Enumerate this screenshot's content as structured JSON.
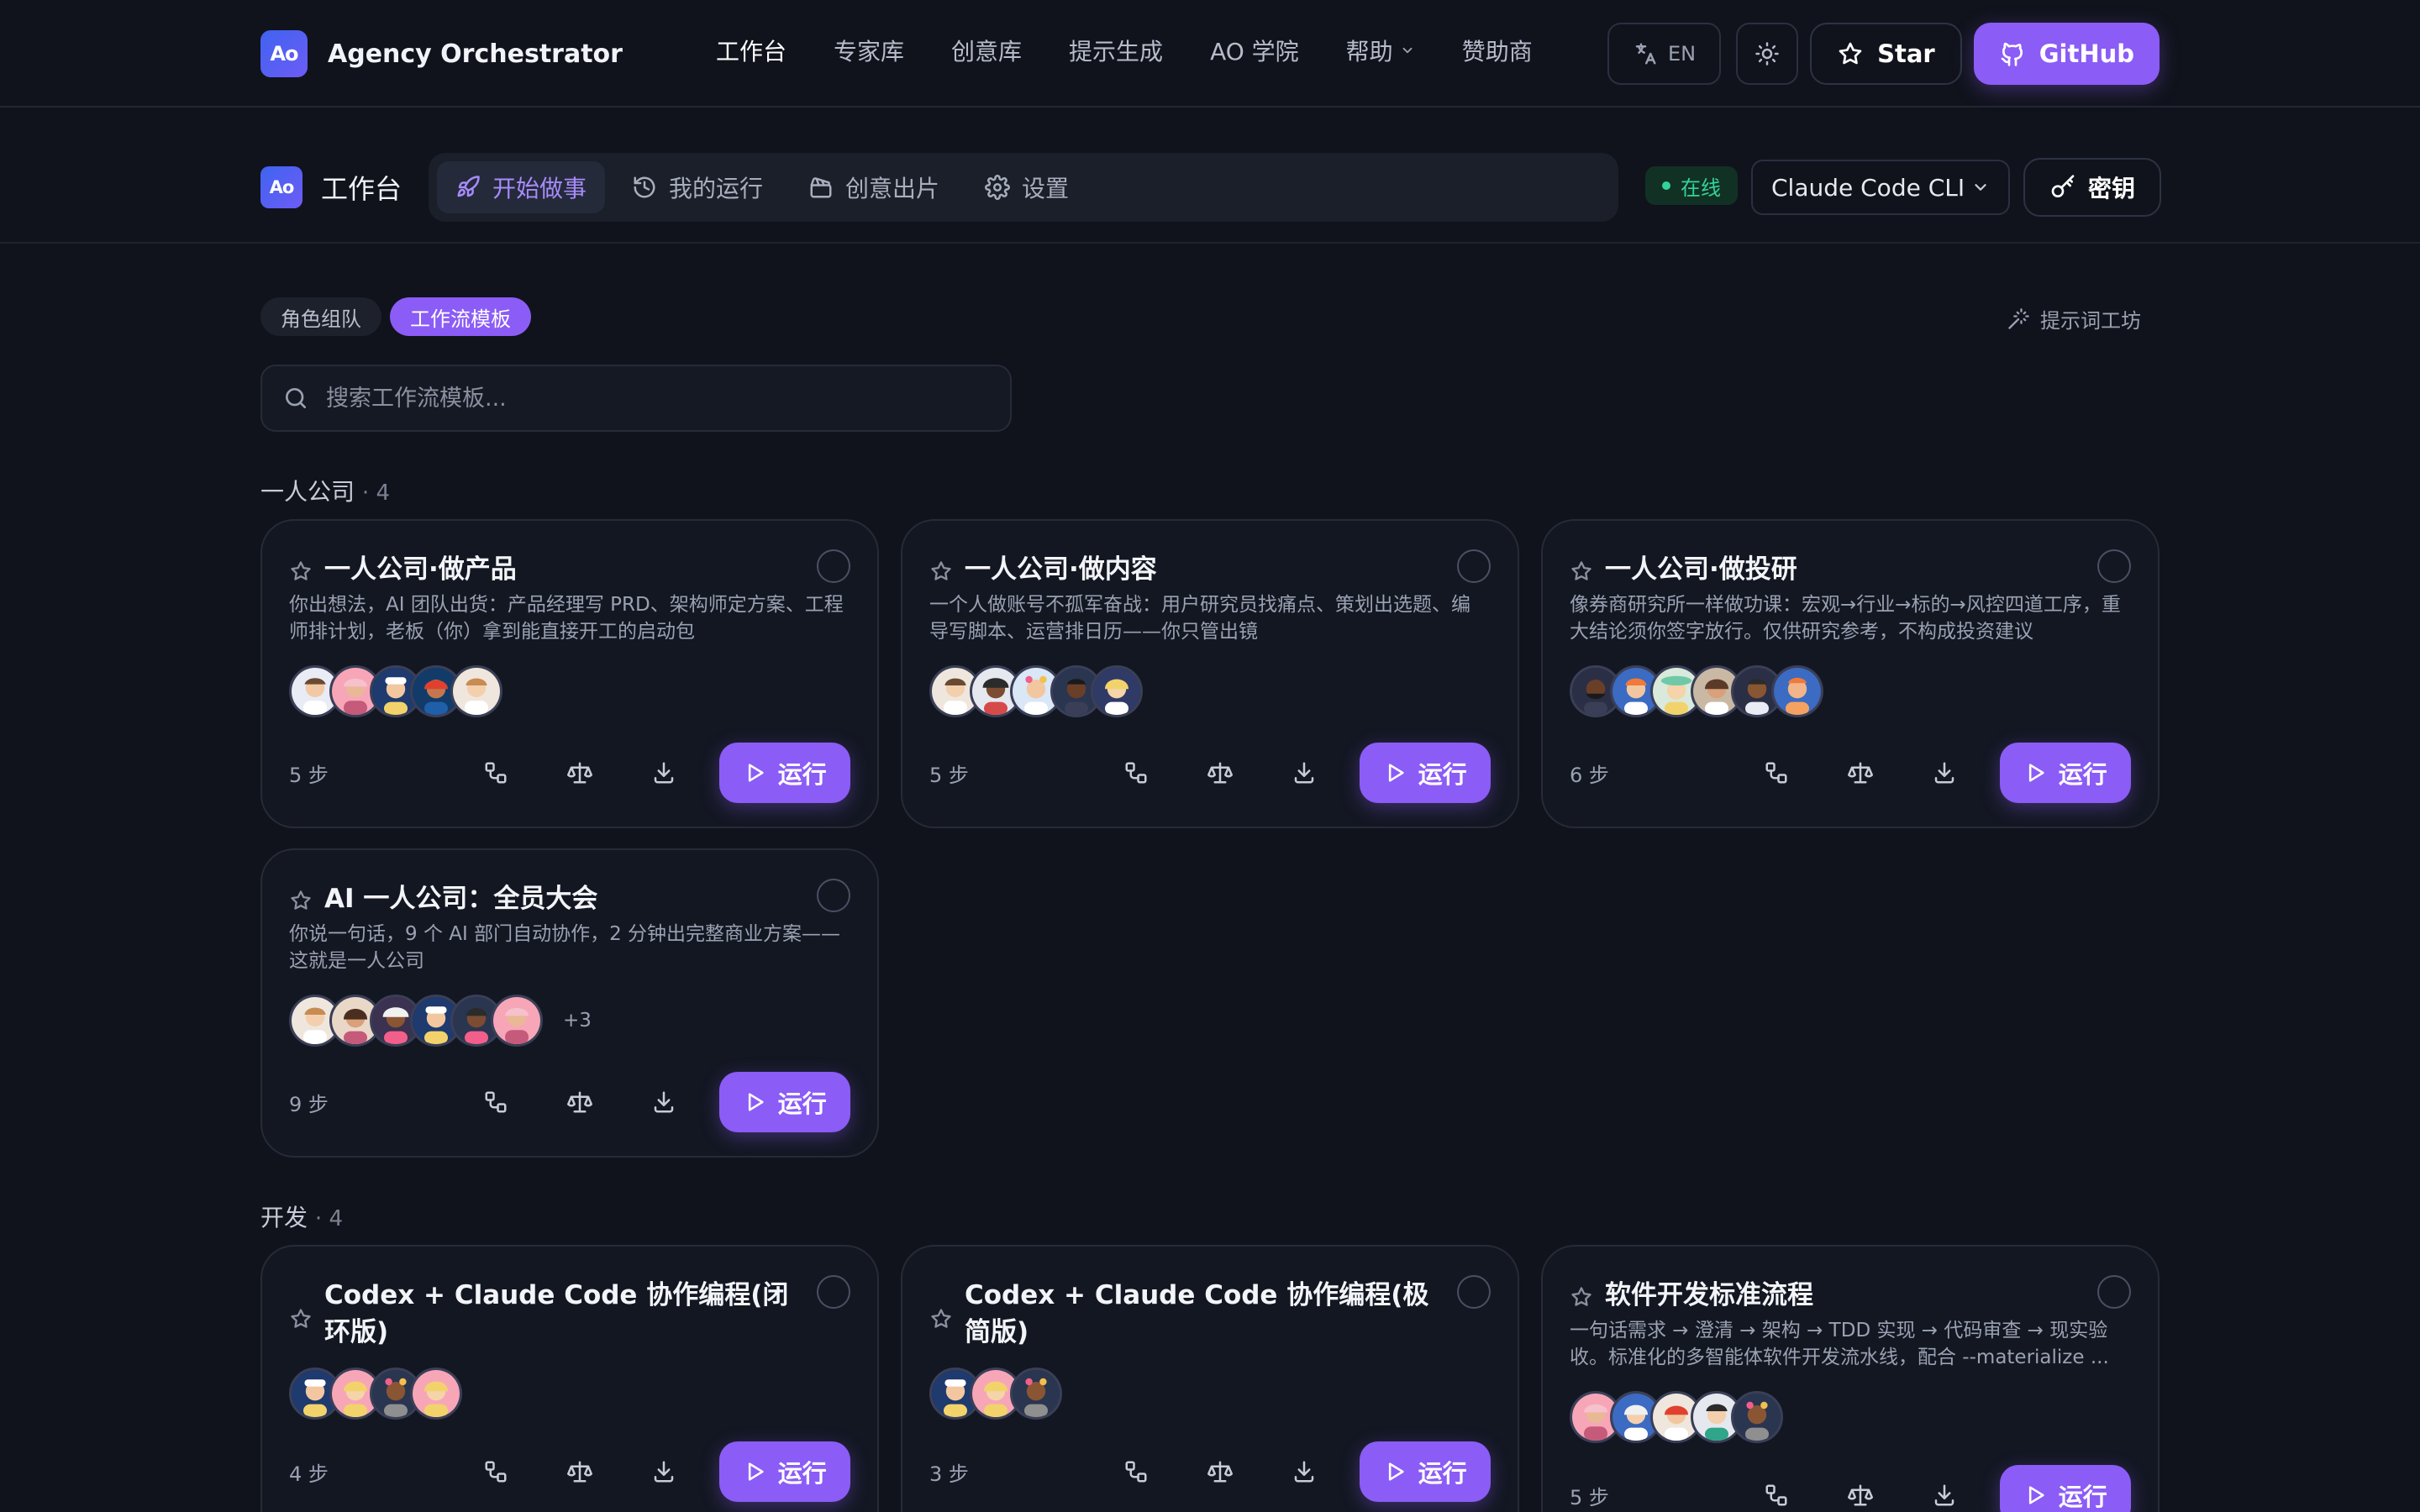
{
  "brand": {
    "logo_text": "Ao",
    "name": "Agency Orchestrator"
  },
  "nav": {
    "links": [
      "工作台",
      "专家库",
      "创意库",
      "提示生成",
      "AO 学院",
      "帮助",
      "赞助商"
    ],
    "lang_label": "EN",
    "star_label": "Star",
    "github_label": "GitHub"
  },
  "workbench": {
    "title": "工作台",
    "tabs": [
      "开始做事",
      "我的运行",
      "创意出片",
      "设置"
    ],
    "status": "在线",
    "cli_selected": "Claude Code CLI",
    "key_label": "密钥"
  },
  "filters": {
    "chips": [
      "角色组队",
      "工作流模板"
    ],
    "prompt_workshop": "提示词工坊"
  },
  "search": {
    "placeholder": "搜索工作流模板..."
  },
  "sections": [
    {
      "title": "一人公司",
      "count": "· 4",
      "cards": [
        {
          "title": "一人公司·做产品",
          "desc": "你出想法，AI 团队出货：产品经理写 PRD、架构师定方案、工程师排计划，老板（你）拿到能直接开工的启动包",
          "steps": "5 步",
          "run": "运行",
          "more": ""
        },
        {
          "title": "一人公司·做内容",
          "desc": "一个人做账号不孤军奋战：用户研究员找痛点、策划出选题、编导写脚本、运营排日历——你只管出镜",
          "steps": "5 步",
          "run": "运行",
          "more": ""
        },
        {
          "title": "一人公司·做投研",
          "desc": "像券商研究所一样做功课：宏观→行业→标的→风控四道工序，重大结论须你签字放行。仅供研究参考，不构成投资建议",
          "steps": "6 步",
          "run": "运行",
          "more": ""
        },
        {
          "title": "AI 一人公司：全员大会",
          "desc": "你说一句话，9 个 AI 部门自动协作，2 分钟出完整商业方案——这就是一人公司",
          "steps": "9 步",
          "run": "运行",
          "more": "+3"
        }
      ]
    },
    {
      "title": "开发",
      "count": "· 4",
      "cards": [
        {
          "title": "Codex + Claude Code 协作编程(闭环版)",
          "desc": "",
          "steps": "4 步",
          "run": "运行",
          "more": ""
        },
        {
          "title": "Codex + Claude Code 协作编程(极简版)",
          "desc": "",
          "steps": "3 步",
          "run": "运行",
          "more": ""
        },
        {
          "title": "软件开发标准流程",
          "desc": "一句话需求 → 澄清 → 架构 → TDD 实现 → 代码审查 → 现实验收。标准化的多智能体软件开发流水线，配合 --materialize ...",
          "steps": "5 步",
          "run": "运行",
          "more": ""
        }
      ]
    }
  ],
  "colors": {
    "accent": "#8b5cf6",
    "background": "#10131b",
    "online": "#34d399"
  }
}
